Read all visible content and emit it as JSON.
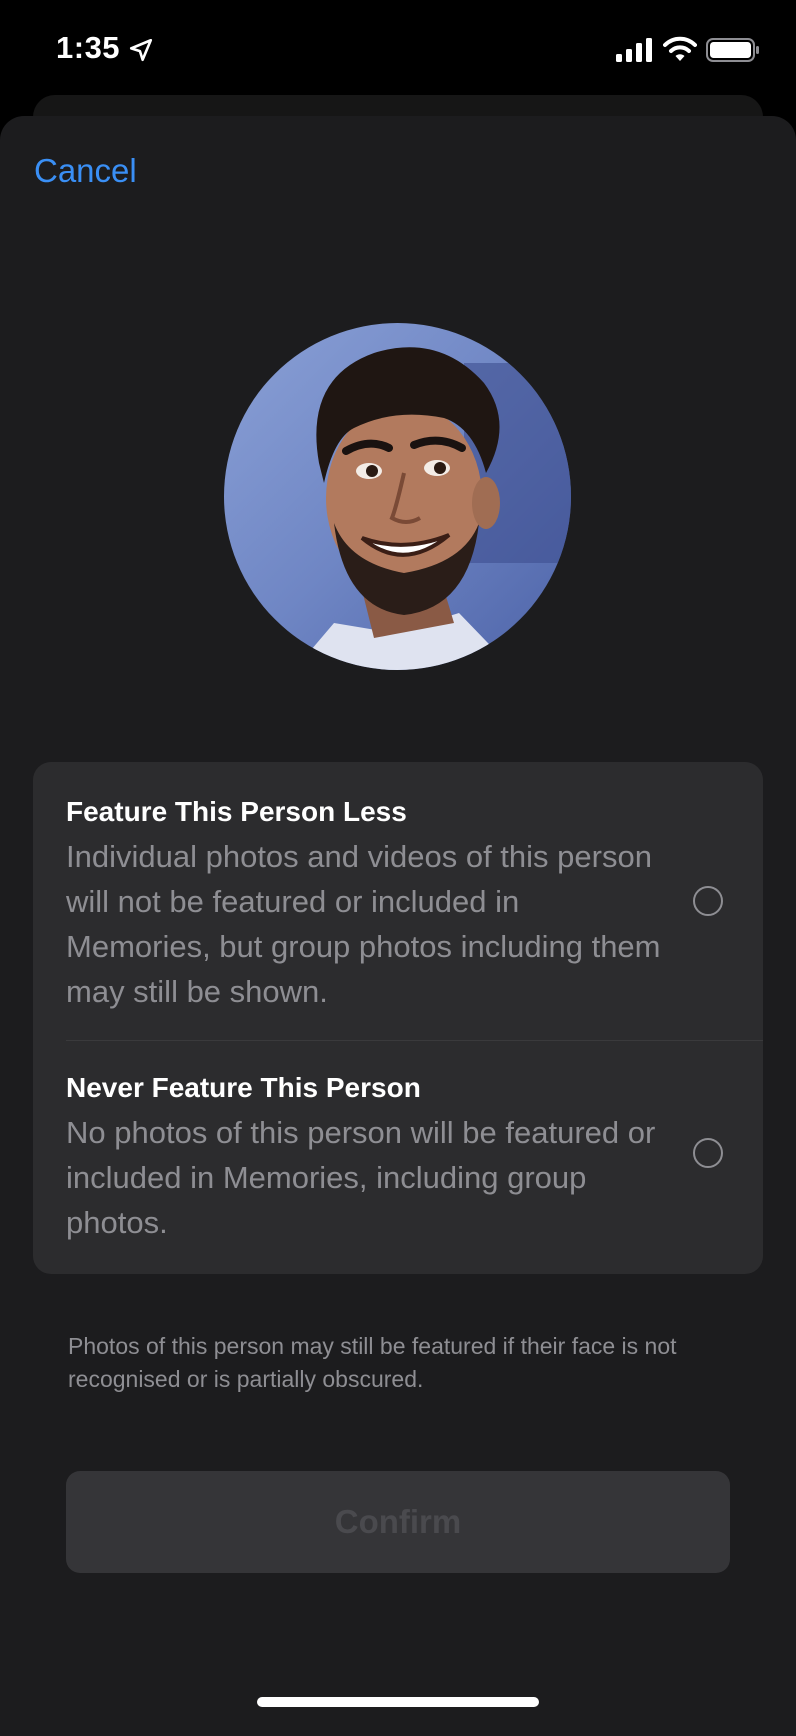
{
  "status_bar": {
    "time": "1:35",
    "icons": [
      "location-arrow-icon",
      "cellular-signal-icon",
      "wifi-icon",
      "battery-icon"
    ]
  },
  "header": {
    "cancel_label": "Cancel"
  },
  "avatar": {
    "description_icon": "person-photo"
  },
  "options": [
    {
      "title": "Feature This Person Less",
      "description": "Individual photos and videos of this person will not be featured or included in Memories, but group photos including them may still be shown.",
      "selected": false
    },
    {
      "title": "Never Feature This Person",
      "description": "No photos of this person will be featured or included in Memories, including group photos.",
      "selected": false
    }
  ],
  "footnote": "Photos of this person may still be featured if their face is not recognised or is partially obscured.",
  "confirm_label": "Confirm",
  "colors": {
    "accent": "#3a8ff5",
    "background": "#1c1c1e",
    "card": "#2c2c2e",
    "secondary_text": "#8e8e93",
    "disabled_button": "#353538"
  }
}
